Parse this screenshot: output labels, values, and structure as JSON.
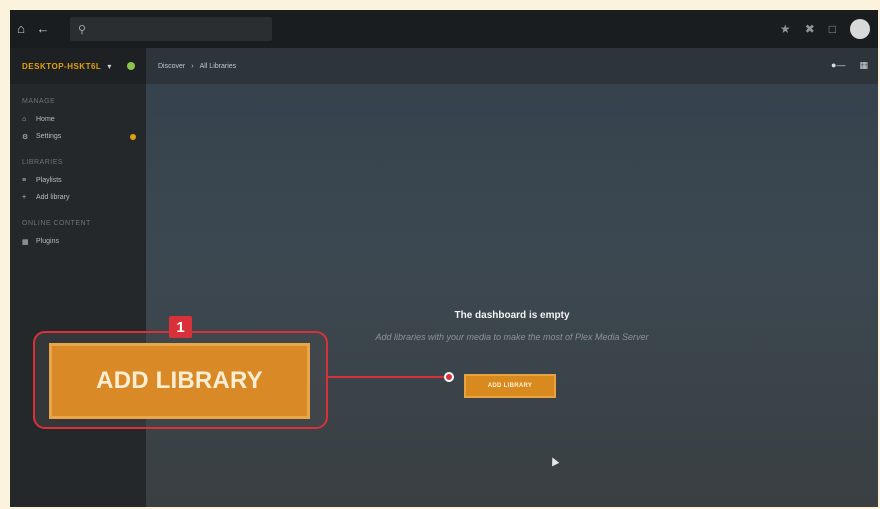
{
  "topbar": {
    "home_icon": "home-icon",
    "back_icon": "arrow-left-icon",
    "search_icon": "search-icon",
    "search_placeholder": "",
    "right_icons": [
      "activity-icon",
      "tools-icon",
      "cast-icon",
      "user-avatar"
    ]
  },
  "sidebar": {
    "server_name": "DESKTOP-HSKT6L",
    "sections": [
      {
        "title": "Manage",
        "items": [
          {
            "label": "Home",
            "icon": "home-icon"
          },
          {
            "label": "Settings",
            "icon": "settings-icon"
          }
        ]
      },
      {
        "title": "Libraries",
        "items": [
          {
            "label": "Playlists",
            "icon": "playlist-icon"
          },
          {
            "label": "Add library",
            "icon": "plus-icon"
          }
        ]
      },
      {
        "title": "Online content",
        "items": [
          {
            "label": "Plugins",
            "icon": "grid-icon"
          }
        ]
      }
    ]
  },
  "main": {
    "breadcrumb": [
      "Discover",
      "All Libraries"
    ],
    "empty_title": "The dashboard is empty",
    "empty_subtitle": "Add libraries with your media to make the most of Plex Media Server",
    "add_library_label": "ADD LIBRARY"
  },
  "callout": {
    "number": "1",
    "label": "ADD LIBRARY"
  },
  "colors": {
    "accent": "#e5a00d",
    "callout_red": "#d9313a",
    "button_orange": "#d98a26"
  }
}
